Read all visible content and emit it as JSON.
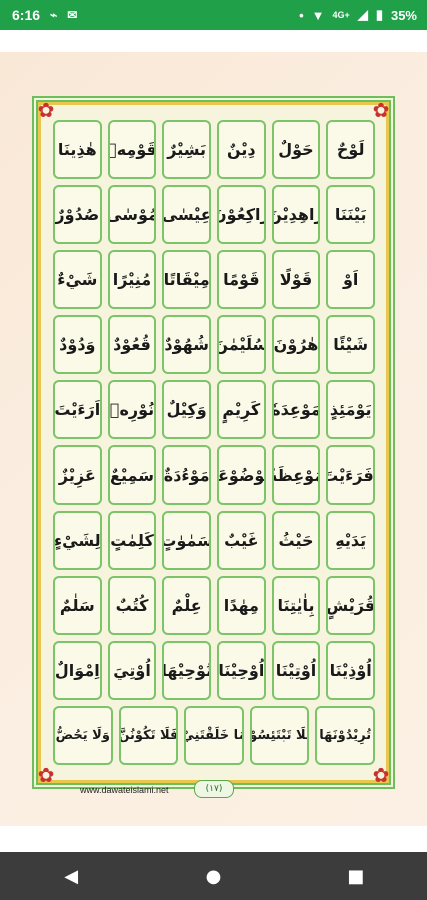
{
  "status_bar": {
    "time": "6:16",
    "signal_label": "4G+",
    "battery": "35%"
  },
  "grid_rows": [
    [
      "هٰذِينَا",
      "قَوْمِهٖ",
      "بَشِيْرٌ",
      "دِيْنٌ",
      "حَوْلٌ",
      "لَوْحٌ"
    ],
    [
      "صُدُوْرٌ",
      "مُوْسٰى",
      "عِيْسٰى",
      "رَاكِعُوْنَ",
      "زَاهِدِيْنَ",
      "بَيْنَنَا"
    ],
    [
      "شَيْءٌ",
      "مُنِيْرًا",
      "مِيْقَاتًا",
      "قَوْمًا",
      "قَوْلًا",
      "اَوْ"
    ],
    [
      "وَدُوْدٌ",
      "قُعُوْدٌ",
      "شُهُوْدٌ",
      "سُلَيْمٰنَ",
      "هٰرُوْنَ",
      "شَيْئًا"
    ],
    [
      "اَرَءَيْتَ",
      "نُوْرِهٖ",
      "وَكِيْلٌ",
      "كَرِيْمٍ",
      "مَوْعِدَهٗ",
      "يَوْمَئِذٍ"
    ],
    [
      "عَزِيْزٌ",
      "سَمِيْعٌ",
      "مَوْءُدَةٌ",
      "مَوْضُوْعَةٌ",
      "مَوْعِظَةٌ",
      "اَفَرَءَيْتَ"
    ],
    [
      "لِشَيْءٍ",
      "كَلِمٰتٍ",
      "سَمٰوٰتٍ",
      "غَيْبٌ",
      "حَيْثُ",
      "يَدَيْهِ"
    ],
    [
      "سَلٰمٌ",
      "كُتُبٌ",
      "عِلْمٌ",
      "مِهٰدًا",
      "بِاٰيٰتِنَا",
      "قُرَيْشٍ"
    ],
    [
      "اِمْوَالٌ",
      "اُوْتِيَ",
      "نُوْحِيْهَا",
      "اُوْحِيْنَا",
      "اُوْتِيْنَا",
      "اُوْذِيْنَا"
    ],
    [
      "وَلَا يَحُضُّ",
      "فَلَا تَكُوْنُنَّ",
      "مَا خَلَقْتَنِيْ",
      "فَلَا تَبْتَئِسُوْا",
      "تُرِيْدُوْنَهَا"
    ]
  ],
  "footer": {
    "url": "www.dawateislami.net",
    "page_number": "(١٧)"
  },
  "nav": {
    "back_icon": "◀",
    "home_icon": "●",
    "recents_icon": "■"
  },
  "colors": {
    "status_bar": "#21a04a",
    "cell_border": "#7cc46a",
    "page_bg": "#fbeee1",
    "nav_bar": "#3c3c3c"
  }
}
